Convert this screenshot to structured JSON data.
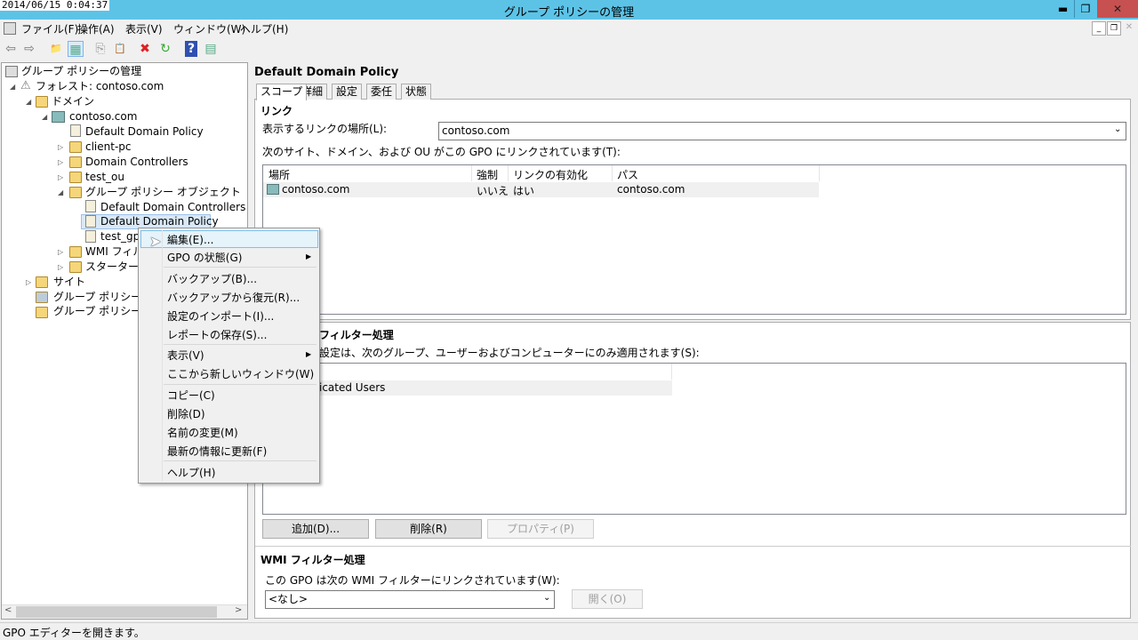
{
  "window": {
    "clock": "2014/06/15 0:04:37",
    "title": "グループ ポリシーの管理",
    "min": "▬",
    "restore": "❐",
    "close": "✕"
  },
  "menubar": [
    "ファイル(F)",
    "操作(A)",
    "表示(V)",
    "ウィンドウ(W)",
    "ヘルプ(H)"
  ],
  "toolbar": {
    "back": "⇦",
    "forward": "⇨",
    "up": "📁",
    "show": "▦",
    "copy": "⎘",
    "paste": "📋",
    "delete": "✖",
    "refresh": "↻",
    "help": "?",
    "view": "▤"
  },
  "tree": {
    "root": "グループ ポリシーの管理",
    "forest": "フォレスト: contoso.com",
    "domains": "ドメイン",
    "domain": "contoso.com",
    "ddp_link": "Default Domain Policy",
    "ous": [
      "client-pc",
      "Domain Controllers",
      "test_ou"
    ],
    "gpo_folder": "グループ ポリシー オブジェクト",
    "gpos": [
      "Default Domain Controllers Pc",
      "Default Domain Policy",
      "test_gp"
    ],
    "wmi": "WMI フィルタ",
    "starter": "スターター GP",
    "sites": "サイト",
    "modeling": "グループ ポリシーのモデ",
    "results": "グループ ポリシーの結"
  },
  "context_menu": {
    "items": [
      "編集(E)...",
      "GPO の状態(G)",
      "バックアップ(B)...",
      "バックアップから復元(R)...",
      "設定のインポート(I)...",
      "レポートの保存(S)...",
      "表示(V)",
      "ここから新しいウィンドウ(W)",
      "コピー(C)",
      "削除(D)",
      "名前の変更(M)",
      "最新の情報に更新(F)",
      "ヘルプ(H)"
    ]
  },
  "details": {
    "title": "Default Domain Policy",
    "tabs": [
      "スコープ",
      "詳細",
      "設定",
      "委任",
      "状態"
    ],
    "links": {
      "heading": "リンク",
      "location_label": "表示するリンクの場所(L):",
      "location_value": "contoso.com",
      "list_label": "次のサイト、ドメイン、および OU がこの GPO にリンクされています(T):",
      "columns": [
        "場所",
        "強制",
        "リンクの有効化",
        "パス"
      ],
      "rows": [
        [
          "contoso.com",
          "いいえ",
          "はい",
          "contoso.com"
        ]
      ]
    },
    "security": {
      "heading_visible": "フィルター処理",
      "desc_visible": "設定は、次のグループ、ユーザーおよびコンピューターにのみ適用されます(S):",
      "row_visible": "icated Users",
      "add": "追加(D)...",
      "remove": "削除(R)",
      "properties": "プロパティ(P)"
    },
    "wmi": {
      "heading": "WMI フィルター処理",
      "label": "この GPO は次の WMI フィルターにリンクされています(W):",
      "value": "<なし>",
      "open": "開く(O)"
    }
  },
  "status": "GPO エディターを開きます。"
}
